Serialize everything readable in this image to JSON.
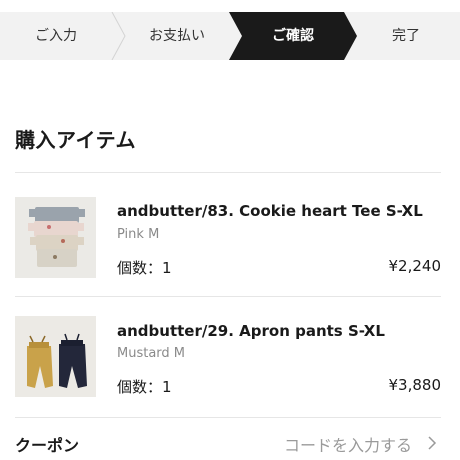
{
  "stepper": {
    "steps": [
      {
        "label": "ご入力",
        "state": "done"
      },
      {
        "label": "お支払い",
        "state": "done"
      },
      {
        "label": "ご確認",
        "state": "current"
      },
      {
        "label": "完了",
        "state": "upcoming"
      }
    ]
  },
  "cart": {
    "title": "購入アイテム",
    "items": [
      {
        "name": "andbutter/83. Cookie heart Tee S-XL",
        "variant": "Pink M",
        "quantity": "個数：1",
        "price": "¥2,240"
      },
      {
        "name": "andbutter/29. Apron pants S-XL",
        "variant": "Mustard M",
        "quantity": "個数：1",
        "price": "¥3,880"
      }
    ]
  },
  "coupon": {
    "label": "クーポン",
    "placeholder": "コードを入力する"
  },
  "colors": {
    "stepper_inactive_bg": "#f2f2f2",
    "stepper_active_bg": "#1a1a1a",
    "divider": "#e6e6e6",
    "muted_text": "#8a8a8a"
  }
}
